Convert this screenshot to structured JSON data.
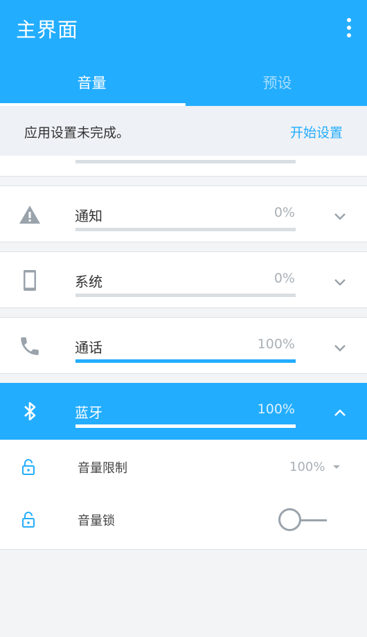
{
  "header": {
    "title": "主界面",
    "menu_icon": "more-vert-icon",
    "tabs": [
      {
        "label": "音量",
        "selected": true
      },
      {
        "label": "预设",
        "selected": false
      }
    ]
  },
  "banner": {
    "message": "应用设置未完成。",
    "action": "开始设置"
  },
  "streams": [
    {
      "label": "通知",
      "percent": "0%",
      "level": 0,
      "icon": "warning-icon",
      "expanded": false
    },
    {
      "label": "系统",
      "percent": "0%",
      "level": 0,
      "icon": "phone-device-icon",
      "expanded": false
    },
    {
      "label": "通话",
      "percent": "100%",
      "level": 1,
      "icon": "call-icon",
      "expanded": false
    },
    {
      "label": "蓝牙",
      "percent": "100%",
      "level": 1,
      "icon": "bluetooth-icon",
      "expanded": true
    }
  ],
  "bluetooth_options": {
    "volume_limit": {
      "label": "音量限制",
      "value": "100%",
      "icon": "lock-icon"
    },
    "volume_lock": {
      "label": "音量锁",
      "enabled": false,
      "icon": "lock-icon"
    }
  },
  "colors": {
    "accent": "#23adff",
    "track": "#d9dee2",
    "muted_icon": "#9aa3ab"
  }
}
